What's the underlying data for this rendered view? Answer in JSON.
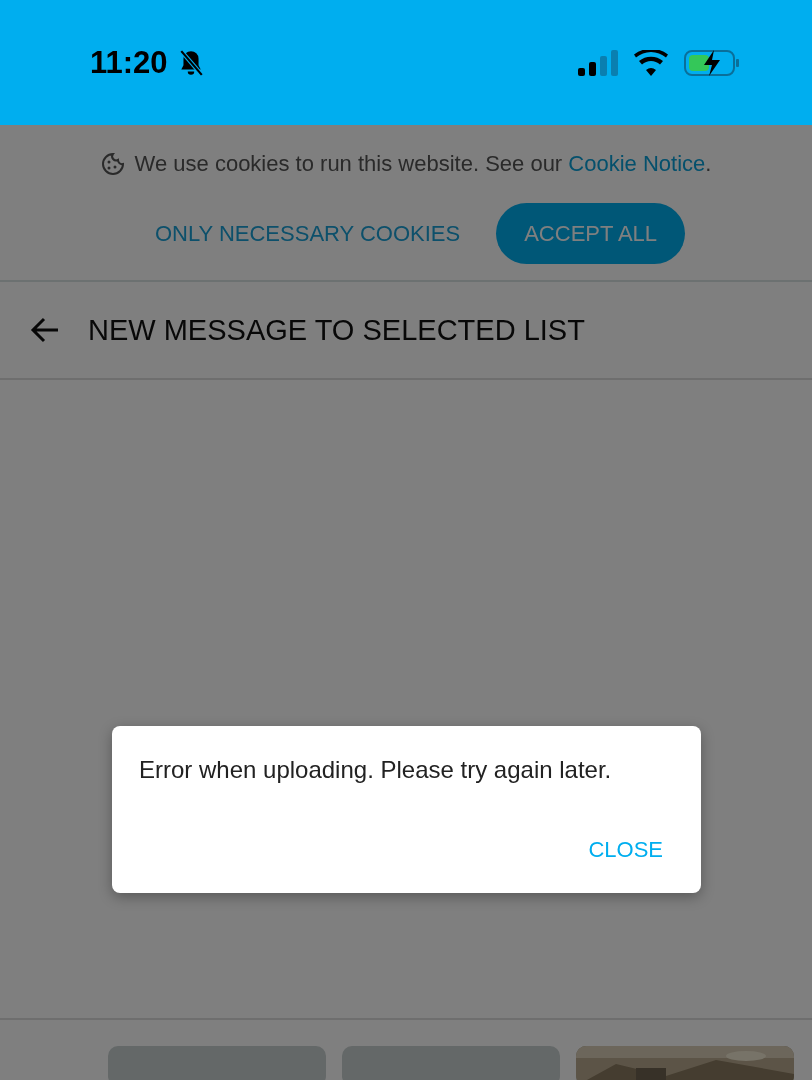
{
  "status_bar": {
    "time": "11:20"
  },
  "cookie_banner": {
    "text": "We use cookies to run this website. See our ",
    "link": "Cookie Notice",
    "text_end": ".",
    "buttons": [
      {
        "label": "ONLY NECESSARY COOKIES",
        "kind": "text"
      },
      {
        "label": "ACCEPT ALL",
        "kind": "filled"
      }
    ]
  },
  "header": {
    "title": "NEW MESSAGE TO SELECTED LIST"
  },
  "thumbnails": [
    {
      "kind": "plain"
    },
    {
      "kind": "plain"
    },
    {
      "kind": "picture"
    }
  ],
  "dialog": {
    "message": "Error when uploading. Please try again later.",
    "button": "CLOSE"
  }
}
